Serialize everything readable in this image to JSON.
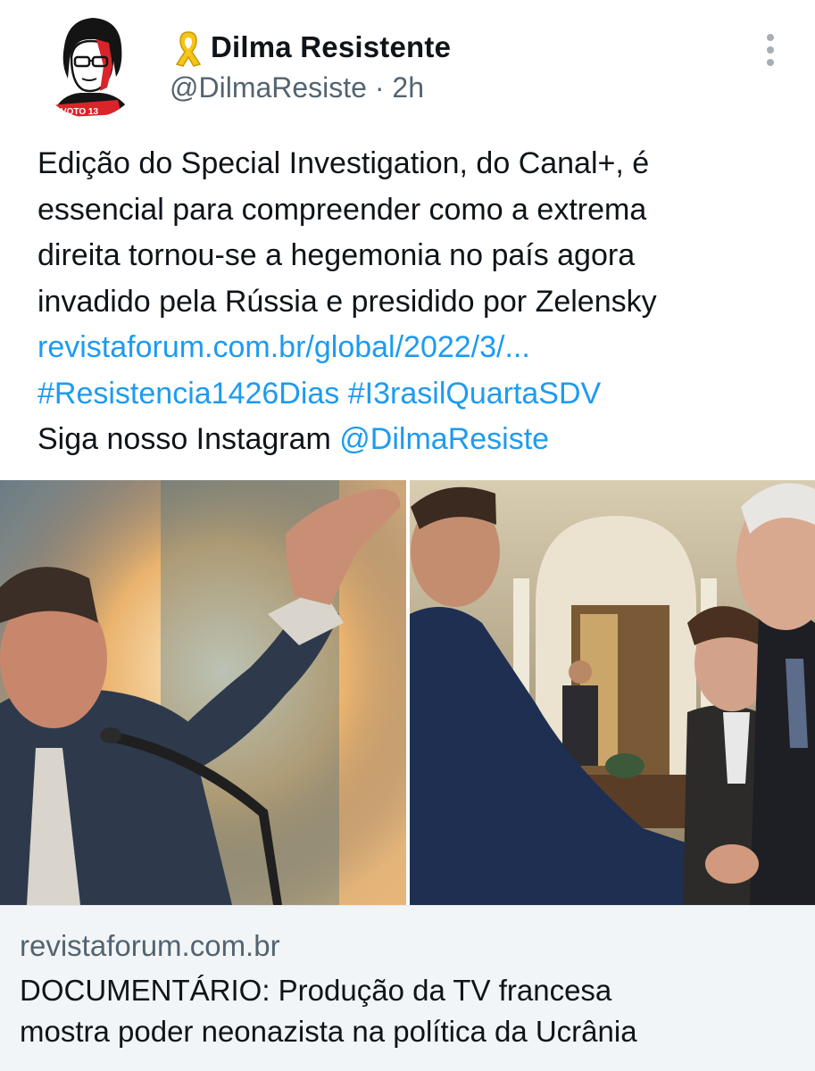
{
  "tweet": {
    "author": {
      "display_name": "Dilma Resistente",
      "handle": "@DilmaResiste",
      "time_sep": "·",
      "time": "2h",
      "badge_icon": "yellow-ribbon-icon",
      "avatar_text": "VOTO 13"
    },
    "more_icon": "more-vertical-icon",
    "text_lines": [
      "Edição do Special Investigation, do Canal+, é",
      "essencial para compreender como a extrema",
      "direita tornou-se a hegemonia no país agora",
      "invadido pela Rússia e presidido por Zelensky"
    ],
    "link": "revistaforum.com.br/global/2022/3/...",
    "hashtags": [
      "#Resistencia1426Dias",
      "#I3rasilQuartaSDV"
    ],
    "instagram_text": "Siga nosso Instagram",
    "instagram_mention": "@DilmaResiste"
  },
  "card": {
    "domain": "revistaforum.com.br",
    "title_lines": [
      "DOCUMENTÁRIO: Produção da TV francesa",
      "mostra poder neonazista na política da Ucrânia"
    ]
  },
  "colors": {
    "link": "#1d9bf0",
    "text": "#0f1419",
    "secondary": "#536471",
    "card_footer_bg": "#f2f5f7",
    "ribbon": "#f5c518"
  }
}
